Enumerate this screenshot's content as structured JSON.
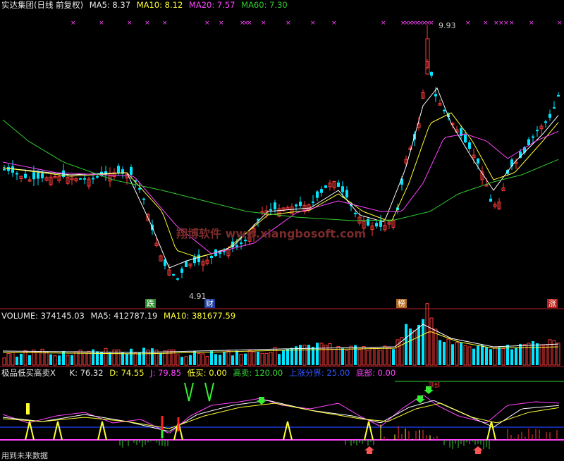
{
  "main": {
    "title": "实达集团(日线 前复权)",
    "ma5_label": "MA5: 8.37",
    "ma10_label": "MA10: 8.12",
    "ma20_label": "MA20: 7.57",
    "ma60_label": "MA60: 7.30",
    "high_marker": "9.93",
    "low_marker": "4.91",
    "watermark": "翔博软件 www.xiangbosoft.com",
    "events": [
      {
        "label": "跌",
        "color": "#2e8b2e"
      },
      {
        "label": "财",
        "color": "#1e3fa0"
      },
      {
        "label": "榜",
        "color": "#b06a20"
      },
      {
        "label": "涨",
        "color": "#b8201c"
      }
    ]
  },
  "volume": {
    "volume_label": "VOLUME: 374145.03",
    "ma5_label": "MA5: 412787.19",
    "ma10_label": "MA10: 381677.59"
  },
  "indicator": {
    "name": "极品低买高卖X",
    "k_label": "K: 76.32",
    "d_label": "D: 74.55",
    "j_label": "J: 79.85",
    "low_buy_label": "低买: 0.00",
    "high_sell_label": "高卖: 120.00",
    "upper_bound_label": "上涨分界: 25.00",
    "bottom_label": "底部: 0.00",
    "small_tag": "顶部"
  },
  "footer": {
    "note": "用到未来数据"
  },
  "colors": {
    "bg": "#000000",
    "up": "#ff3b3b",
    "down": "#00e5ff",
    "ma5": "#ffffff",
    "ma10": "#ffff33",
    "ma20": "#ff44ff",
    "ma60": "#33cc33",
    "separator": "#b4202a"
  }
}
